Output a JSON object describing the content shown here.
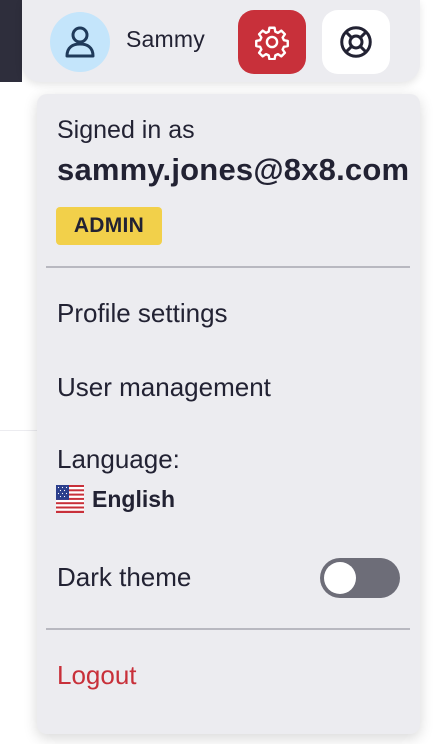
{
  "header": {
    "user_name": "Sammy",
    "avatar_icon": "user-icon",
    "settings_icon": "gear-icon",
    "help_icon": "lifebuoy-icon",
    "settings_active_color": "#c8303a"
  },
  "menu": {
    "signed_in_label": "Signed in as",
    "email": "sammy.jones@8x8.com",
    "role_badge": "ADMIN",
    "items": [
      {
        "label": "Profile settings"
      },
      {
        "label": "User management"
      }
    ],
    "language": {
      "label": "Language:",
      "value": "English",
      "flag_icon": "us-flag-icon"
    },
    "dark_theme": {
      "label": "Dark theme",
      "enabled": false
    },
    "logout_label": "Logout"
  },
  "colors": {
    "danger": "#c8303a",
    "badge": "#f2d04a",
    "avatar_bg": "#c4e5fb",
    "surface": "#ececf0"
  }
}
